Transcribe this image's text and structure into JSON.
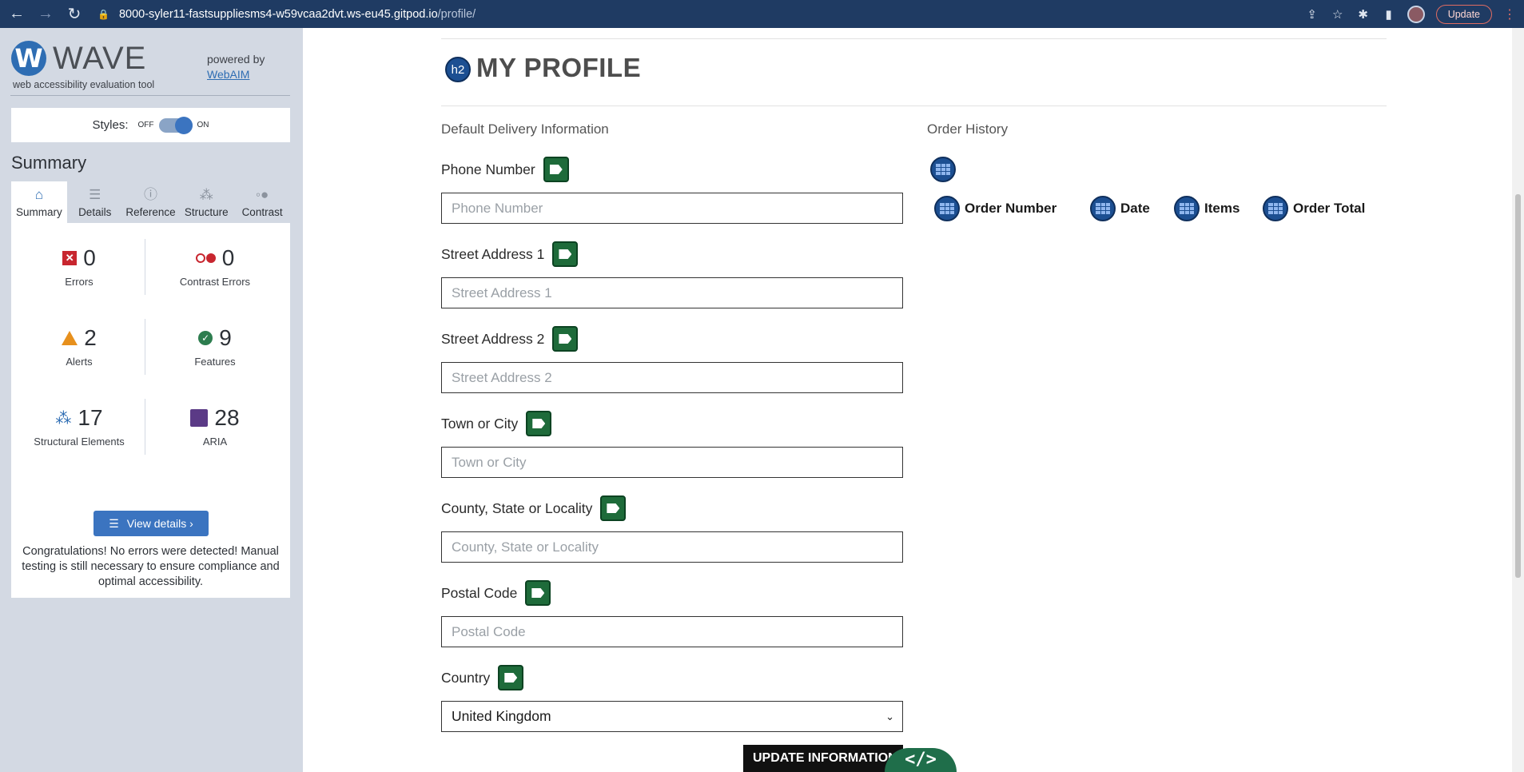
{
  "browser": {
    "url_host": "8000-syler11-fastsuppliesms4-w59vcaa2dvt.ws-eu45.gitpod.io",
    "url_path": "/profile/",
    "update_label": "Update"
  },
  "wave": {
    "logo_letter": "W",
    "title": "WAVE",
    "subtitle": "web accessibility evaluation tool",
    "powered_by": "powered by",
    "powered_link": "WebAIM",
    "styles_label": "Styles:",
    "styles_off": "OFF",
    "styles_on": "ON",
    "summary_heading": "Summary",
    "tabs": [
      {
        "label": "Summary",
        "icon": "home-icon"
      },
      {
        "label": "Details",
        "icon": "list-icon"
      },
      {
        "label": "Reference",
        "icon": "info-icon"
      },
      {
        "label": "Structure",
        "icon": "structure-icon"
      },
      {
        "label": "Contrast",
        "icon": "contrast-icon"
      }
    ],
    "stats": {
      "errors": {
        "count": "0",
        "label": "Errors"
      },
      "contrast_errors": {
        "count": "0",
        "label": "Contrast Errors"
      },
      "alerts": {
        "count": "2",
        "label": "Alerts"
      },
      "features": {
        "count": "9",
        "label": "Features"
      },
      "structural": {
        "count": "17",
        "label": "Structural Elements"
      },
      "aria": {
        "count": "28",
        "label": "ARIA"
      }
    },
    "view_details": "View details ›",
    "congrats": "Congratulations! No errors were detected! Manual testing is still necessary to ensure compliance and optimal accessibility.",
    "colors": {
      "error": "#c8262f",
      "alert": "#e7901d",
      "feature": "#2d7d4f",
      "structure": "#2e6db3",
      "aria": "#5b3a86"
    }
  },
  "page": {
    "h2_badge": "h2",
    "title": "MY PROFILE",
    "delivery_heading": "Default Delivery Information",
    "order_history_heading": "Order History",
    "fields": [
      {
        "label": "Phone Number",
        "placeholder": "Phone Number"
      },
      {
        "label": "Street Address 1",
        "placeholder": "Street Address 1"
      },
      {
        "label": "Street Address 2",
        "placeholder": "Street Address 2"
      },
      {
        "label": "Town or City",
        "placeholder": "Town or City"
      },
      {
        "label": "County, State or Locality",
        "placeholder": "County, State or Locality"
      },
      {
        "label": "Postal Code",
        "placeholder": "Postal Code"
      }
    ],
    "country_label": "Country",
    "country_value": "United Kingdom",
    "update_button": "UPDATE INFORMATION",
    "code_overlay": "</>",
    "order_columns": [
      "Order Number",
      "Date",
      "Items",
      "Order Total"
    ]
  }
}
